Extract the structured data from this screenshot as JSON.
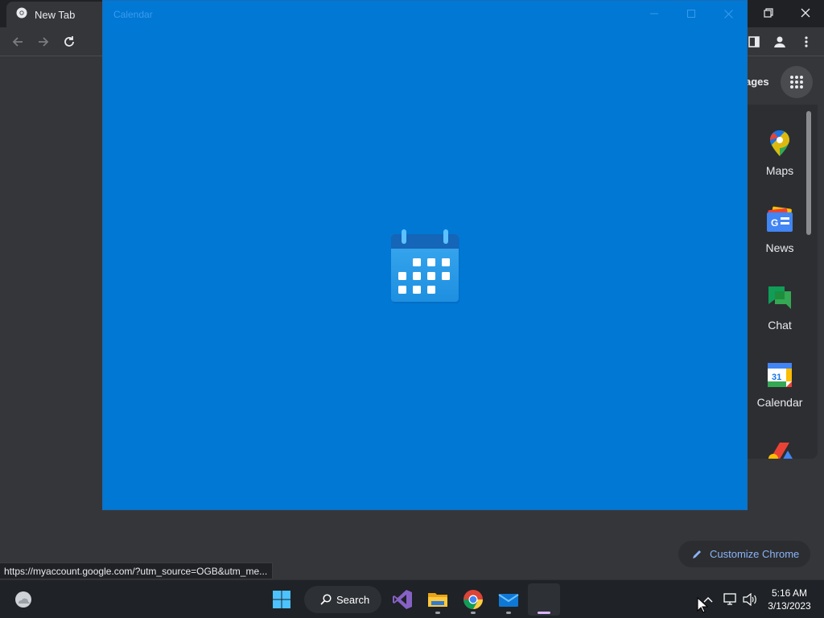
{
  "browser": {
    "tab_title": "New Tab",
    "images_link": "ages",
    "status_url": "https://myaccount.google.com/?utm_source=OGB&utm_me...",
    "customize_label": "Customize Chrome"
  },
  "apps": [
    {
      "label": "Maps",
      "icon": "maps-icon"
    },
    {
      "label": "News",
      "icon": "news-icon"
    },
    {
      "label": "Chat",
      "icon": "chat-icon"
    },
    {
      "label": "Calendar",
      "icon": "calendar-icon"
    },
    {
      "label": "",
      "icon": "google-ads-icon"
    }
  ],
  "calendar_window": {
    "title": "Calendar"
  },
  "taskbar": {
    "search_label": "Search",
    "time": "5:16 AM",
    "date": "3/13/2023"
  },
  "colors": {
    "splash_blue": "#0078d4",
    "chrome_dark": "#35363a",
    "link_blue": "#8ab4f8"
  }
}
